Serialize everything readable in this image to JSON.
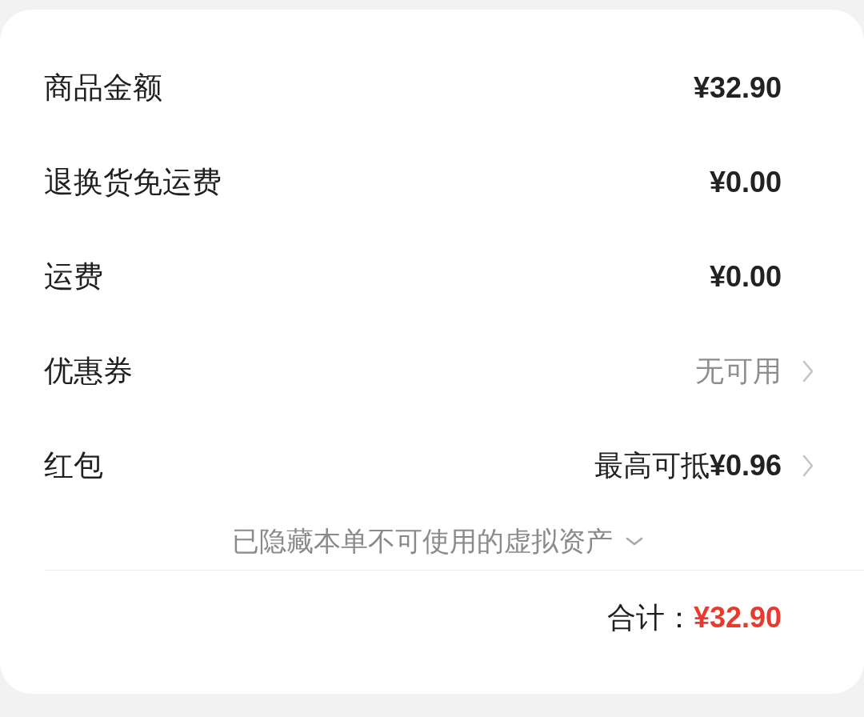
{
  "rows": [
    {
      "label": "商品金额",
      "value": "¥32.90",
      "kind": "amount"
    },
    {
      "label": "退换货免运费",
      "value": "¥0.00",
      "kind": "amount"
    },
    {
      "label": "运费",
      "value": "¥0.00",
      "kind": "amount"
    },
    {
      "label": "优惠券",
      "value": "无可用",
      "kind": "muted_link"
    },
    {
      "label": "红包",
      "value": "最高可抵**¥0.96**",
      "kind": "link"
    }
  ],
  "hidden_assets_toggle": {
    "label": "已隐藏本单不可使用的虚拟资产",
    "expanded": false
  },
  "total": {
    "label": "合计：",
    "value": "¥32.90"
  }
}
